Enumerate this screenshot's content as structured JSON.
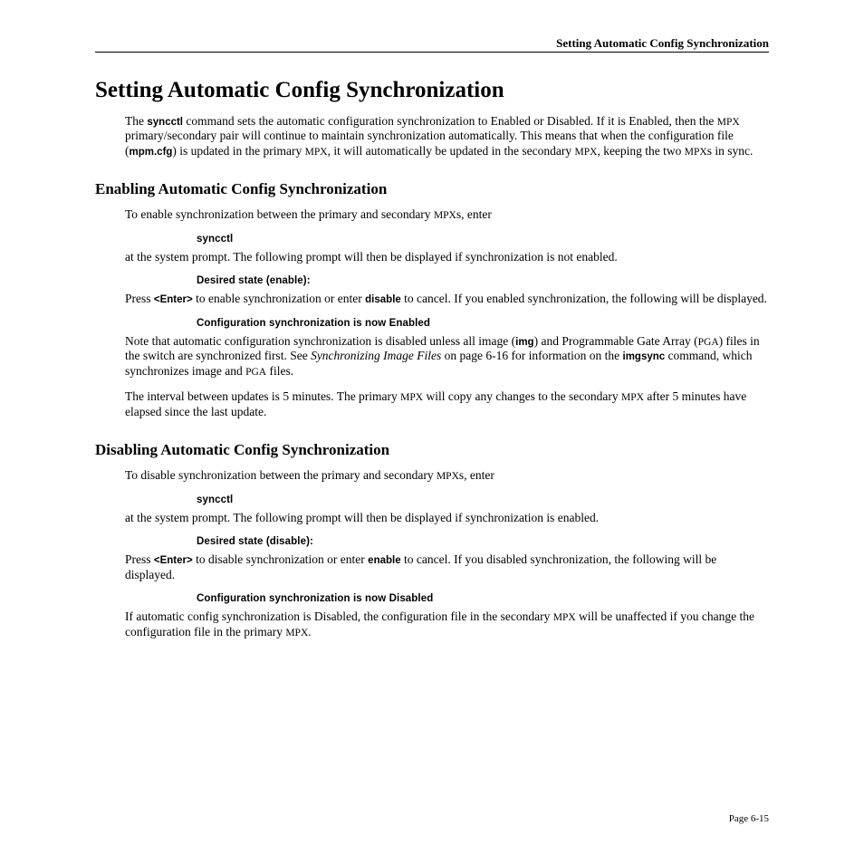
{
  "header": "Setting Automatic Config Synchronization",
  "title": "Setting Automatic Config Synchronization",
  "intro_html": "The <b class='sans'>syncctl</b> command sets the automatic configuration synchronization to Enabled or Disabled. If it is Enabled, then the <span class='sc'>MPX</span> primary/secondary pair will continue to maintain synchronization automatically. This means that when the configuration file (<b class='sans'>mpm.cfg</b>) is updated in the primary <span class='sc'>MPX</span>, it will automatically be updated in the secondary <span class='sc'>MPX</span>, keeping the two <span class='sc'>MPX</span>s in sync.",
  "enable": {
    "heading": "Enabling Automatic Config Synchronization",
    "p1": "To enable synchronization between the primary and secondary <span class='sc'>MPX</span>s, enter",
    "cmd1": "syncctl",
    "p2": "at the system prompt. The following prompt will then be displayed if synchronization is not enabled.",
    "cmd2": "Desired state (enable):",
    "p3": "Press <b class='sans'>&lt;Enter&gt;</b> to enable synchronization or enter <b class='sans'>disable</b> to cancel. If you enabled synchronization, the following will be displayed.",
    "cmd3": "Configuration synchronization is now Enabled",
    "p4": "Note that automatic configuration synchronization is disabled unless all image (<b class='sans'>img</b>) and Programmable Gate Array (<span class='sc'>PGA</span>) files in the switch are synchronized first. See <i>Synchronizing Image Files</i> on page 6-16 for information on the <b class='sans'>imgsync</b> command, which synchronizes image and <span class='sc'>PGA</span> files.",
    "p5": "The interval between updates is 5 minutes. The primary <span class='sc'>MPX</span> will copy any changes to the secondary <span class='sc'>MPX</span> after 5 minutes have elapsed since the last update."
  },
  "disable": {
    "heading": "Disabling Automatic Config Synchronization",
    "p1": "To disable synchronization between the primary and secondary <span class='sc'>MPX</span>s, enter",
    "cmd1": "syncctl",
    "p2": "at the system prompt. The following prompt will then be displayed if synchronization is enabled.",
    "cmd2": "Desired state (disable):",
    "p3": "Press <b class='sans'>&lt;Enter&gt;</b> to disable synchronization or enter <b class='sans'>enable</b> to cancel. If you disabled synchronization, the following will be displayed.",
    "cmd3": "Configuration synchronization is now Disabled",
    "p4": "If automatic config synchronization is Disabled, the configuration file in the secondary <span class='sc'>MPX</span> will be unaffected if you change the configuration file in the primary <span class='sc'>MPX</span>."
  },
  "footer": "Page 6-15"
}
